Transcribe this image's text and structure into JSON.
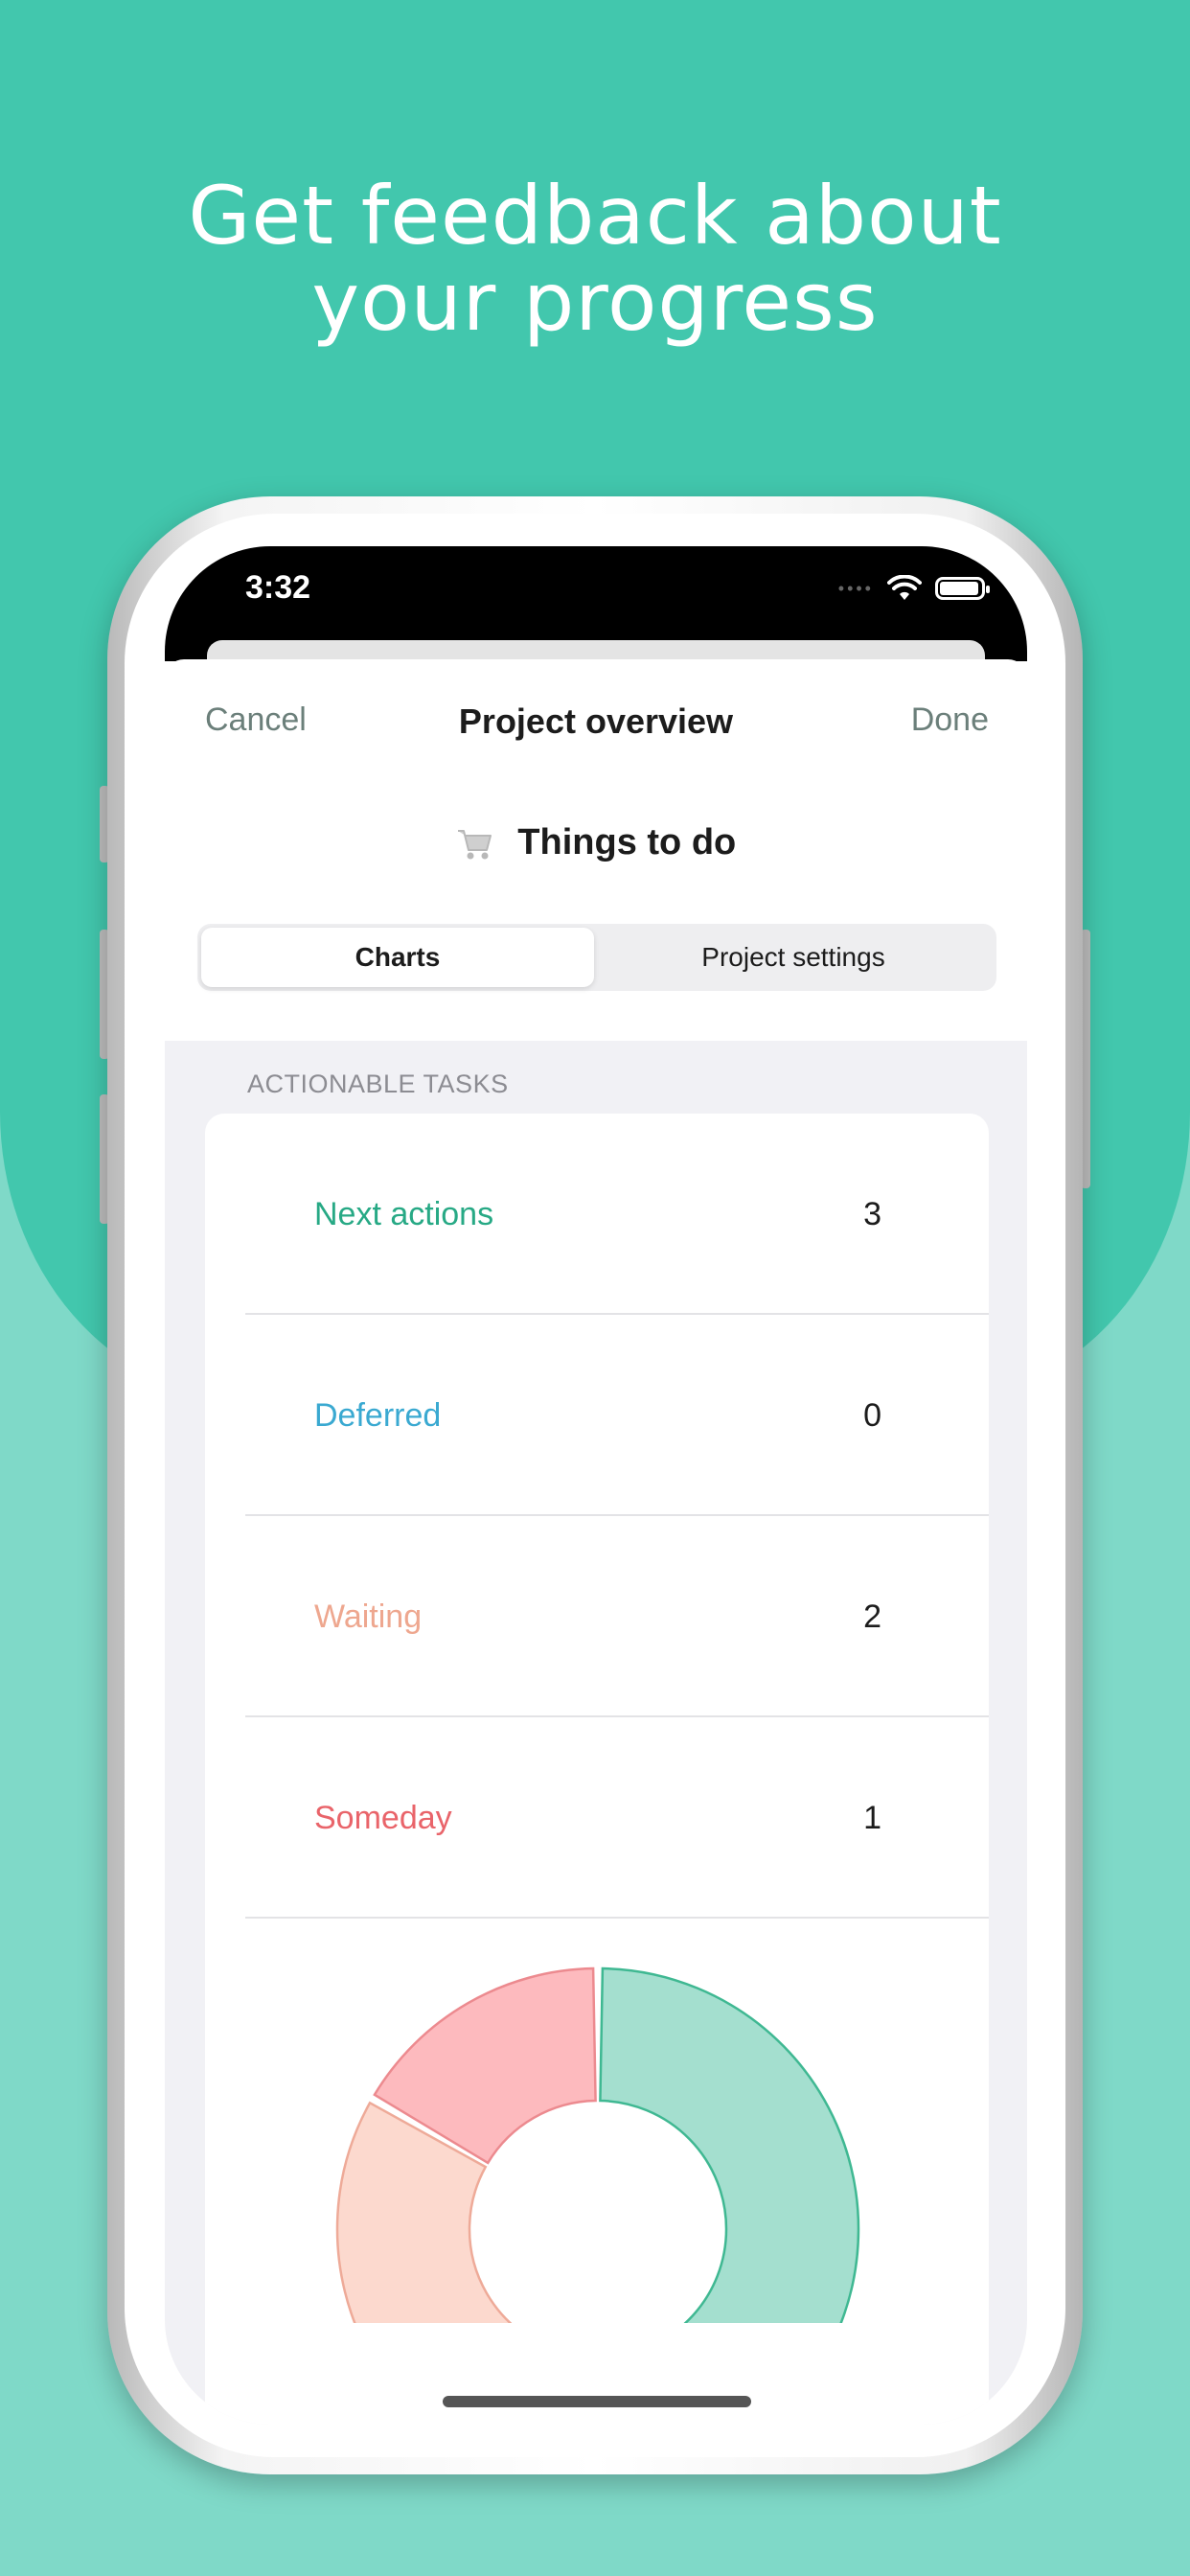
{
  "headline": {
    "line1": "Get feedback about",
    "line2": "your progress"
  },
  "status_bar": {
    "time": "3:32"
  },
  "nav": {
    "cancel": "Cancel",
    "title": "Project overview",
    "done": "Done"
  },
  "project": {
    "name": "Things to do",
    "icon": "cart-icon"
  },
  "segmented": {
    "charts": "Charts",
    "settings": "Project settings"
  },
  "section": {
    "header": "ACTIONABLE TASKS"
  },
  "rows": [
    {
      "label": "Next actions",
      "count": "3",
      "color": "#27a985"
    },
    {
      "label": "Deferred",
      "count": "0",
      "color": "#3aa9d1"
    },
    {
      "label": "Waiting",
      "count": "2",
      "color": "#eea78f"
    },
    {
      "label": "Someday",
      "count": "1",
      "color": "#e9646a"
    }
  ],
  "chart_data": {
    "type": "pie",
    "categories": [
      "Next actions",
      "Deferred",
      "Waiting",
      "Someday"
    ],
    "values": [
      3,
      0,
      2,
      1
    ],
    "colors": [
      "#a4dfcf",
      "#a7d8ee",
      "#fcd9ce",
      "#fdbabe"
    ],
    "stroke_colors": [
      "#3fb892",
      "#3aa9d1",
      "#eeaa98",
      "#ec8a8f"
    ],
    "donut": true
  }
}
